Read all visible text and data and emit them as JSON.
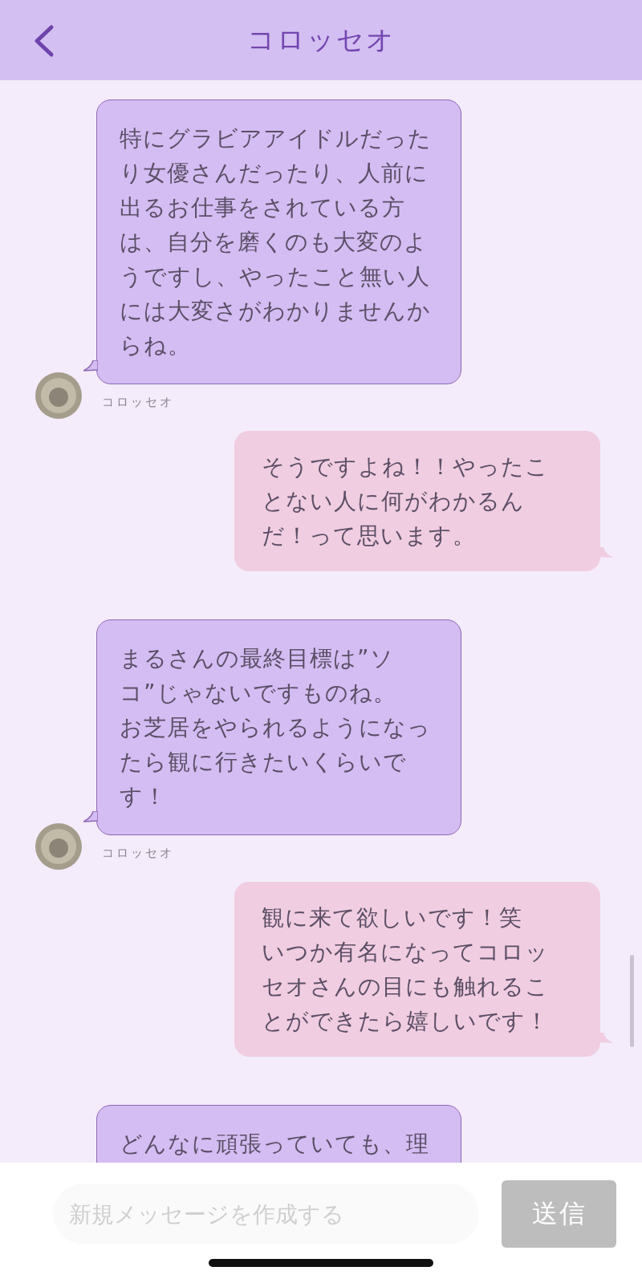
{
  "header": {
    "title": "コロッセオ"
  },
  "messages": [
    {
      "kind": "received",
      "sender": "コロッセオ",
      "text": "特にグラビアアイドルだったり女優さんだったり、人前に出るお仕事をされている方は、自分を磨くのも大変のようですし、やったこと無い人には大変さがわかりませんからね。"
    },
    {
      "kind": "sent",
      "text": "そうですよね！！やったことない人に何がわかるんだ！って思います。"
    },
    {
      "kind": "received",
      "sender": "コロッセオ",
      "paragraphs": [
        "まるさんの最終目標は”ソコ”じゃないですものね。",
        "お芝居をやられるようになったら観に行きたいくらいです！"
      ]
    },
    {
      "kind": "sent",
      "paragraphs": [
        "観に来て欲しいです！笑",
        "いつか有名になってコロッセオさんの目にも触れることができたら嬉しいです！"
      ]
    },
    {
      "kind": "received",
      "text": "どんなに頑張っていても、理",
      "cut_off": true
    }
  ],
  "composer": {
    "placeholder": "新規メッセージを作成する",
    "send_label": "送信"
  }
}
